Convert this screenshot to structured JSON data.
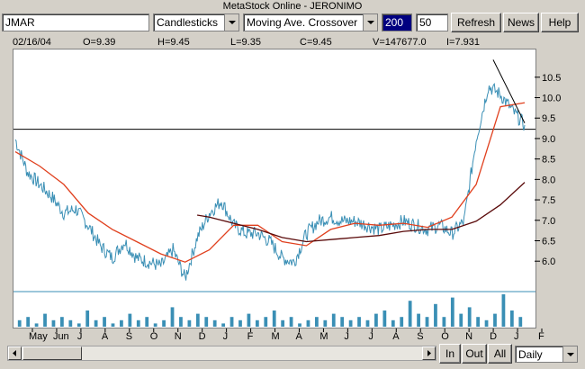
{
  "window": {
    "title": "MetaStock Online - JERONIMO"
  },
  "toolbar": {
    "symbol": "JMAR",
    "chart_style": "Candlesticks",
    "indicator": "Moving Ave. Crossover",
    "period_a": "200",
    "period_b": "50",
    "refresh_label": "Refresh",
    "news_label": "News",
    "help_label": "Help"
  },
  "quote": {
    "date": "02/16/04",
    "open": "O=9.39",
    "high": "H=9.45",
    "low": "L=9.35",
    "close": "C=9.45",
    "volume": "V=147677.0",
    "interest": "I=7.931"
  },
  "bottom_bar": {
    "in_label": "In",
    "out_label": "Out",
    "all_label": "All",
    "interval": "Daily"
  },
  "colors": {
    "price": "#3a8fb5",
    "ma_fast": "#e0401e",
    "ma_slow": "#5a0a0a",
    "hline": "#000000",
    "volume": "#3a8fb5"
  },
  "chart_data": {
    "type": "line",
    "title": "",
    "x_tick_labels": [
      "May",
      "Jun",
      "J",
      "A",
      "S",
      "O",
      "N",
      "D",
      "J",
      "F",
      "M",
      "A",
      "M",
      "J",
      "J",
      "A",
      "S",
      "O",
      "N",
      "D",
      "J",
      "F"
    ],
    "y_tick_labels": [
      "10.5",
      "10.0",
      "9.5",
      "9.0",
      "8.5",
      "8.0",
      "7.5",
      "7.0",
      "6.5",
      "6.0"
    ],
    "ylim": [
      5.3,
      11.2
    ],
    "horizontal_line": 9.25,
    "series": [
      {
        "key": "price",
        "x": [
          0,
          0.5,
          1,
          1.5,
          2,
          2.5,
          3,
          3.5,
          4,
          4.5,
          5,
          5.5,
          6,
          6.5,
          7,
          7.5,
          8,
          8.5,
          9,
          9.5,
          10,
          10.5,
          11,
          11.5,
          12,
          12.5,
          13,
          13.5,
          14,
          14.5,
          15,
          15.5,
          16,
          16.5,
          17,
          17.5,
          18,
          18.5,
          19,
          19.5,
          20,
          20.5,
          21
        ],
        "values": [
          9.0,
          8.2,
          7.9,
          7.6,
          7.2,
          7.3,
          6.9,
          6.4,
          6.1,
          6.5,
          6.1,
          6.0,
          5.9,
          6.3,
          5.6,
          6.6,
          7.2,
          7.5,
          6.9,
          6.7,
          6.7,
          6.5,
          6.1,
          6.0,
          6.7,
          7.0,
          7.1,
          7.0,
          7.0,
          6.9,
          6.8,
          6.9,
          7.0,
          6.9,
          6.8,
          6.9,
          6.7,
          7.0,
          9.0,
          10.3,
          10.1,
          9.7,
          9.35
        ]
      },
      {
        "key": "ma_fast",
        "x": [
          0,
          1,
          2,
          3,
          4,
          5,
          6,
          7,
          8,
          9,
          10,
          11,
          12,
          13,
          14,
          15,
          16,
          17,
          18,
          19,
          20,
          21
        ],
        "values": [
          8.7,
          8.35,
          7.9,
          7.2,
          6.8,
          6.5,
          6.2,
          6.0,
          6.3,
          6.9,
          6.9,
          6.5,
          6.4,
          6.8,
          6.95,
          6.9,
          6.95,
          6.85,
          7.1,
          7.9,
          9.8,
          9.9
        ]
      },
      {
        "key": "ma_slow",
        "x": [
          7.5,
          8,
          9,
          10,
          11,
          12,
          13,
          14,
          15,
          16,
          17,
          18,
          19,
          20,
          21
        ],
        "values": [
          7.15,
          7.1,
          6.95,
          6.8,
          6.6,
          6.5,
          6.55,
          6.6,
          6.65,
          6.75,
          6.8,
          6.8,
          7.0,
          7.4,
          7.95
        ]
      }
    ],
    "trendline": {
      "x": [
        19.7,
        21
      ],
      "values": [
        10.95,
        9.4
      ]
    },
    "volume_bars": [
      2,
      3,
      1,
      4,
      2,
      3,
      2,
      1,
      5,
      2,
      3,
      1,
      2,
      4,
      2,
      3,
      1,
      2,
      6,
      3,
      2,
      4,
      3,
      2,
      1,
      3,
      2,
      4,
      2,
      3,
      5,
      2,
      3,
      1,
      2,
      3,
      2,
      4,
      3,
      2,
      3,
      2,
      4,
      5,
      2,
      3,
      8,
      4,
      3,
      7,
      3,
      9,
      4,
      6,
      3,
      2,
      4,
      10,
      5,
      3
    ]
  }
}
